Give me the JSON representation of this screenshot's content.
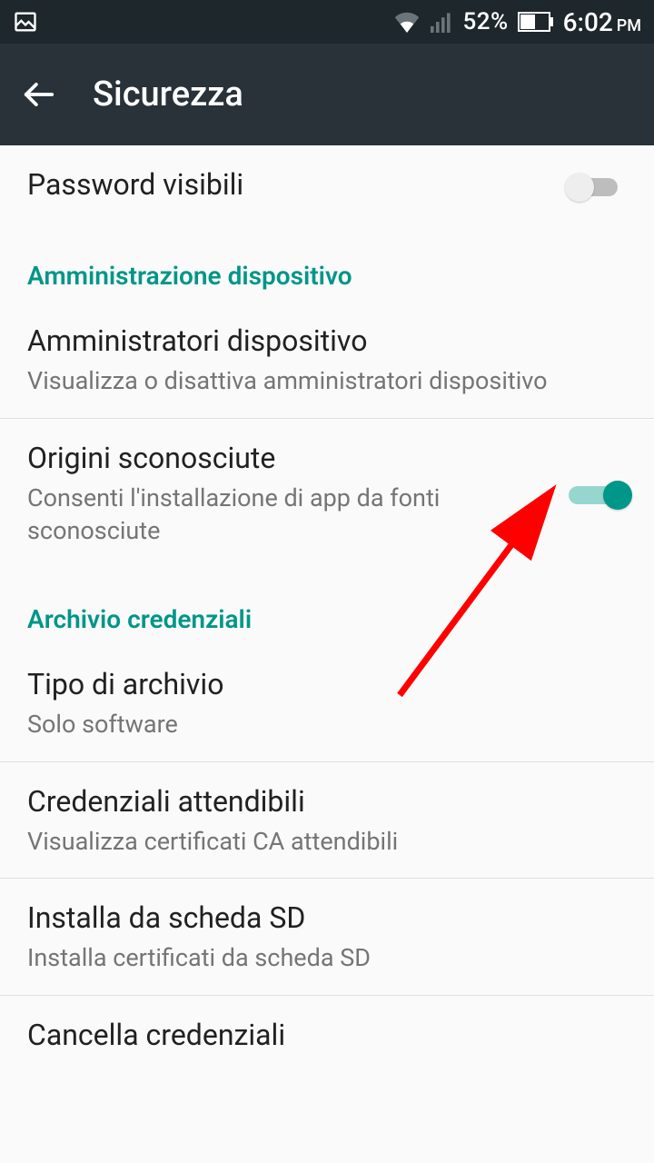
{
  "status": {
    "battery_pct": "52%",
    "time": "6:02",
    "ampm": "PM"
  },
  "appbar": {
    "title": "Sicurezza"
  },
  "rows": {
    "passwords": {
      "title": "Password visibili"
    },
    "section_admin": "Amministrazione dispositivo",
    "admins": {
      "title": "Amministratori dispositivo",
      "sub": "Visualizza o disattiva amministratori dispositivo"
    },
    "unknown": {
      "title": "Origini sconosciute",
      "sub": "Consenti l'installazione di app da fonti sconosciute"
    },
    "section_cred": "Archivio credenziali",
    "storage_type": {
      "title": "Tipo di archivio",
      "sub": "Solo software"
    },
    "trusted": {
      "title": "Credenziali attendibili",
      "sub": "Visualizza certificati CA attendibili"
    },
    "install_sd": {
      "title": "Installa da scheda SD",
      "sub": "Installa certificati da scheda SD"
    },
    "clear": {
      "title": "Cancella credenziali"
    }
  }
}
